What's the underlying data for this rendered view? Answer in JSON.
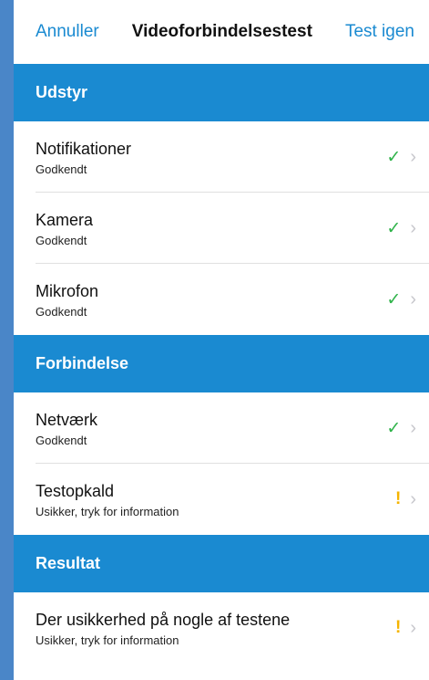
{
  "navbar": {
    "cancel": "Annuller",
    "title": "Videoforbindelsestest",
    "retry": "Test igen"
  },
  "sections": {
    "equipment": {
      "header": "Udstyr"
    },
    "connection": {
      "header": "Forbindelse"
    },
    "result": {
      "header": "Resultat"
    }
  },
  "rows": [
    {
      "title": "Notifikationer",
      "sub": "Godkendt",
      "status": "check",
      "icon": "✓"
    },
    {
      "title": "Kamera",
      "sub": "Godkendt",
      "status": "check",
      "icon": "✓"
    },
    {
      "title": "Mikrofon",
      "sub": "Godkendt",
      "status": "check",
      "icon": "✓"
    },
    {
      "title": "Netværk",
      "sub": "Godkendt",
      "status": "check",
      "icon": "✓"
    },
    {
      "title": "Testopkald",
      "sub": "Usikker, tryk for information",
      "status": "warning",
      "icon": "!"
    },
    {
      "title": "Der usikkerhed på nogle af testene",
      "sub": "Usikker, tryk for information",
      "status": "warning",
      "icon": "!"
    }
  ],
  "chevron": "›",
  "colors": {
    "accent": "#1a8ad1",
    "success": "#2fb34a",
    "warning": "#f5b400"
  }
}
